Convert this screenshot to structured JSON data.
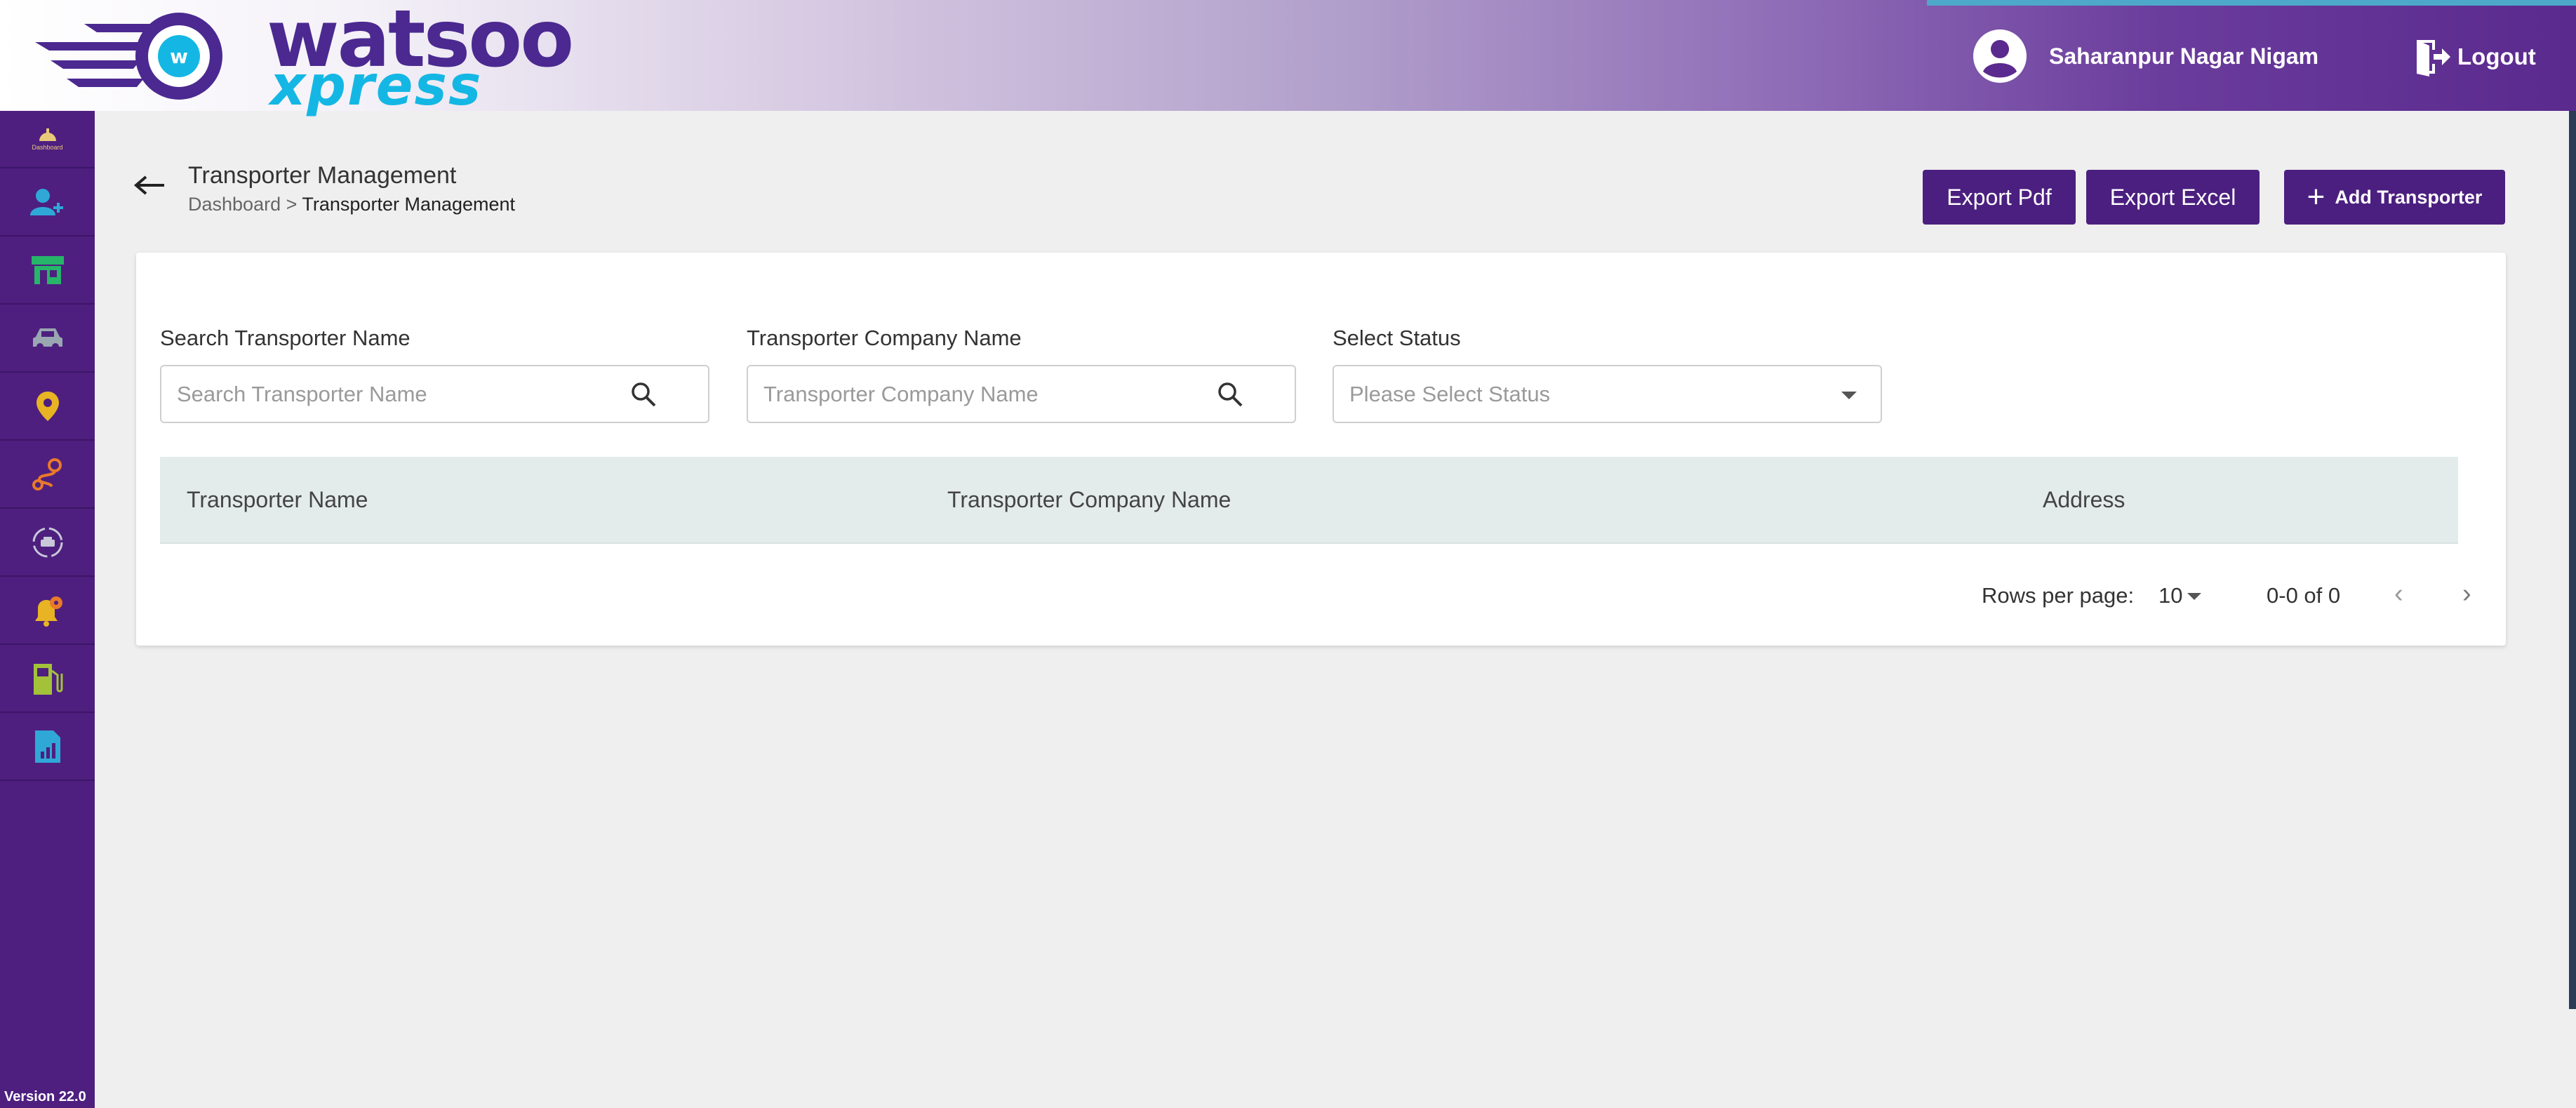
{
  "header": {
    "logo_word_top": "watsoo",
    "logo_word_bottom": "xpress",
    "user_name": "Saharanpur Nagar Nigam",
    "logout_label": "Logout"
  },
  "sidebar": {
    "items": [
      {
        "icon": "dashboard-icon",
        "label": "Dashboard"
      },
      {
        "icon": "add-user-icon"
      },
      {
        "icon": "store-icon"
      },
      {
        "icon": "car-icon"
      },
      {
        "icon": "location-pin-icon"
      },
      {
        "icon": "route-icon"
      },
      {
        "icon": "vehicle-cycle-icon"
      },
      {
        "icon": "alert-settings-icon"
      },
      {
        "icon": "fuel-station-icon"
      },
      {
        "icon": "report-icon"
      }
    ],
    "version": "Version 22.0"
  },
  "page": {
    "title": "Transporter Management",
    "breadcrumb_root": "Dashboard",
    "breadcrumb_sep": ">",
    "breadcrumb_current": "Transporter Management"
  },
  "actions": {
    "export_pdf": "Export Pdf",
    "export_excel": "Export Excel",
    "add_transporter": "Add Transporter"
  },
  "filters": {
    "search_label": "Search Transporter Name",
    "search_placeholder": "Search Transporter Name",
    "company_label": "Transporter Company Name",
    "company_placeholder": "Transporter Company Name",
    "status_label": "Select Status",
    "status_placeholder": "Please Select Status"
  },
  "table": {
    "columns": [
      "Transporter Name",
      "Transporter Company Name",
      "Address"
    ],
    "rows": []
  },
  "pagination": {
    "rows_label": "Rows per page:",
    "rows_value": "10",
    "range": "0-0 of 0",
    "prev": "‹",
    "next": "›"
  },
  "colors": {
    "brand_purple": "#4b1f7f",
    "sidebar": "#4e1f7f",
    "accent_cyan": "#14b7e4"
  }
}
